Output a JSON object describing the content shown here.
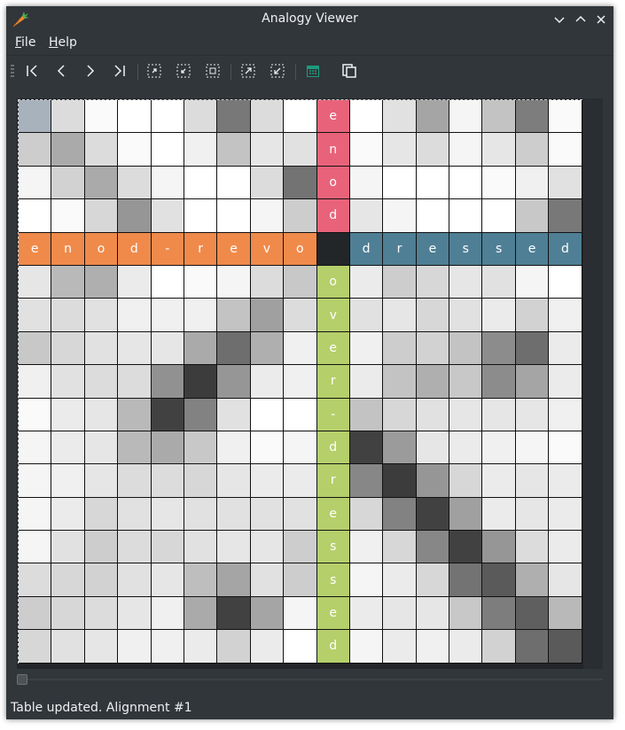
{
  "window": {
    "title": "Analogy Viewer"
  },
  "menubar": {
    "items": [
      {
        "label": "File",
        "mnemonic": "F",
        "rest": "ile"
      },
      {
        "label": "Help",
        "mnemonic": "H",
        "rest": "elp"
      }
    ]
  },
  "toolbar": {
    "icons": [
      "first-icon",
      "previous-icon",
      "next-icon",
      "last-icon",
      "expand-selection-icon",
      "shrink-selection-icon",
      "fit-icon",
      "expand-all-icon",
      "shrink-all-icon",
      "calendar-icon",
      "copy-icon"
    ]
  },
  "colors": {
    "row_header": "#e8637a",
    "col_header_left": "#f08a4b",
    "col_header_right": "#4f7f95",
    "row_header_lower": "#b5cf6b",
    "corner": "#232629"
  },
  "grid": {
    "top_left_word": [
      "e",
      "n",
      "o",
      "d",
      "-",
      "r",
      "e",
      "v",
      "o"
    ],
    "top_right_word": [
      "d",
      "r",
      "e",
      "s",
      "s",
      "e",
      "d"
    ],
    "upper_row_labels": [
      "e",
      "n",
      "o",
      "d"
    ],
    "lower_row_labels": [
      "o",
      "v",
      "e",
      "r",
      "-",
      "d",
      "r",
      "e",
      "s",
      "s",
      "e",
      "d"
    ],
    "upper_cells": [
      [
        190,
        220,
        250,
        255,
        255,
        220,
        120,
        220,
        255,
        255,
        225,
        165,
        245,
        195,
        125,
        250
      ],
      [
        205,
        170,
        220,
        250,
        255,
        240,
        195,
        230,
        225,
        250,
        230,
        220,
        245,
        230,
        205,
        250
      ],
      [
        245,
        210,
        170,
        220,
        245,
        255,
        255,
        220,
        115,
        245,
        255,
        255,
        255,
        250,
        240,
        225
      ],
      [
        255,
        250,
        215,
        150,
        225,
        255,
        255,
        245,
        205,
        230,
        245,
        255,
        255,
        255,
        200,
        120
      ]
    ],
    "lower_cells": [
      [
        230,
        185,
        175,
        235,
        255,
        250,
        245,
        220,
        200,
        235,
        205,
        215,
        230,
        225,
        245,
        255
      ],
      [
        225,
        220,
        225,
        240,
        240,
        240,
        195,
        160,
        220,
        225,
        230,
        215,
        225,
        235,
        210,
        240
      ],
      [
        200,
        215,
        225,
        230,
        230,
        170,
        110,
        175,
        240,
        240,
        205,
        210,
        195,
        140,
        110,
        235
      ],
      [
        240,
        225,
        220,
        220,
        145,
        60,
        150,
        235,
        240,
        235,
        195,
        175,
        200,
        140,
        165,
        235
      ],
      [
        250,
        235,
        230,
        185,
        65,
        130,
        225,
        255,
        255,
        195,
        215,
        225,
        230,
        230,
        230,
        240
      ],
      [
        245,
        235,
        230,
        185,
        170,
        200,
        240,
        250,
        245,
        65,
        155,
        230,
        235,
        240,
        245,
        250
      ],
      [
        245,
        240,
        230,
        220,
        220,
        215,
        230,
        235,
        235,
        135,
        60,
        150,
        215,
        235,
        230,
        235
      ],
      [
        245,
        235,
        215,
        225,
        230,
        225,
        225,
        225,
        225,
        215,
        130,
        65,
        160,
        235,
        230,
        235
      ],
      [
        245,
        225,
        205,
        220,
        215,
        225,
        230,
        230,
        205,
        240,
        215,
        135,
        65,
        150,
        220,
        235
      ],
      [
        220,
        215,
        210,
        225,
        230,
        190,
        165,
        225,
        205,
        245,
        235,
        215,
        115,
        90,
        175,
        230
      ],
      [
        205,
        215,
        220,
        230,
        240,
        170,
        65,
        165,
        245,
        235,
        230,
        230,
        200,
        125,
        95,
        185
      ],
      [
        215,
        225,
        230,
        240,
        240,
        235,
        210,
        235,
        255,
        245,
        235,
        240,
        235,
        210,
        110,
        90
      ]
    ]
  },
  "status": {
    "text": "Table updated. Alignment #1"
  }
}
